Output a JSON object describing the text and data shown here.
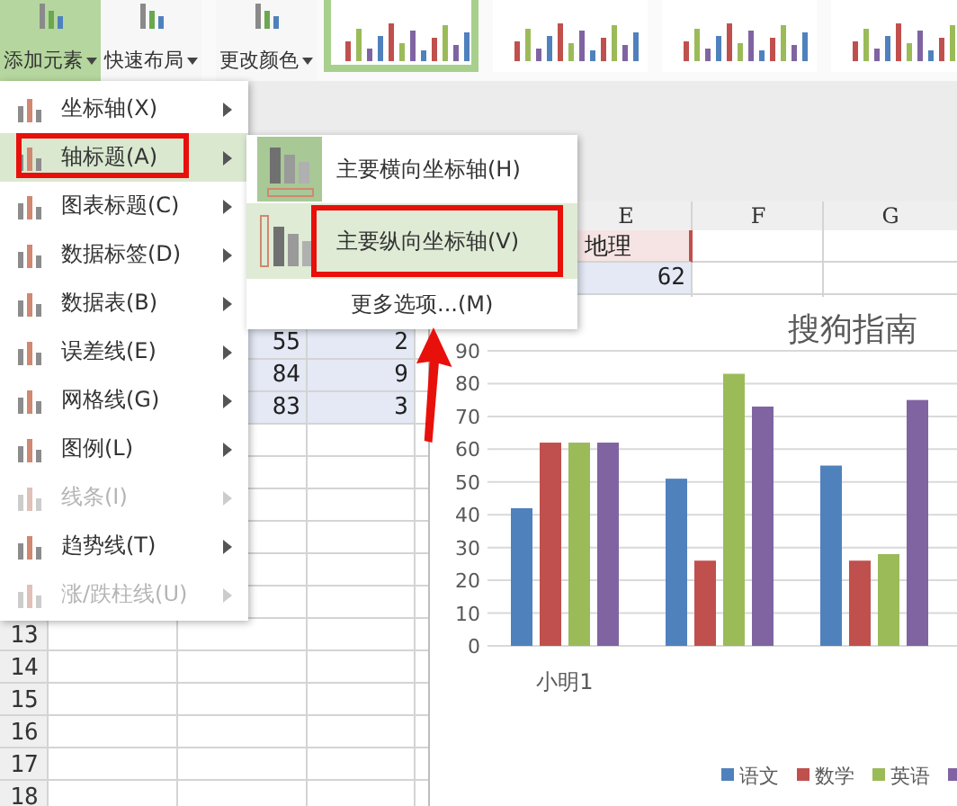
{
  "ribbon": {
    "buttons": [
      {
        "label": "添加元素",
        "selected": true
      },
      {
        "label": "快速布局",
        "selected": false
      },
      {
        "label": "更改颜色",
        "selected": false
      }
    ],
    "chart_styles": [
      {
        "selected": true
      },
      {
        "selected": false
      },
      {
        "selected": false
      },
      {
        "selected": false
      }
    ]
  },
  "sheet": {
    "column_headers": [
      "E",
      "F",
      "G"
    ],
    "row_numbers": [
      "13",
      "14",
      "15",
      "16",
      "17",
      "18"
    ],
    "cells": [
      {
        "text": "地理",
        "kind": "series_name"
      },
      {
        "text": "62",
        "kind": "value"
      },
      {
        "text": "55",
        "kind": "value"
      },
      {
        "text": "2",
        "kind": "value"
      },
      {
        "text": "84",
        "kind": "value"
      },
      {
        "text": "9",
        "kind": "value"
      },
      {
        "text": "83",
        "kind": "value"
      },
      {
        "text": "3",
        "kind": "value"
      }
    ]
  },
  "chart": {
    "chart_data": {
      "type": "bar",
      "title": "搜狗指南",
      "grid": true,
      "legend": true,
      "categories": [
        "小明1",
        null,
        null
      ],
      "ylim": [
        0,
        90
      ],
      "yticks": [
        0,
        10,
        20,
        30,
        40,
        50,
        60,
        70,
        80,
        90
      ],
      "series": [
        {
          "name": "语文",
          "color": "#4f81bd",
          "values": [
            42,
            51,
            55
          ]
        },
        {
          "name": "数学",
          "color": "#c0504d",
          "values": [
            62,
            26,
            26
          ]
        },
        {
          "name": "英语",
          "color": "#9bbb59",
          "values": [
            62,
            83,
            28
          ]
        },
        {
          "color": "#8064a2",
          "values": [
            62,
            73,
            75
          ]
        }
      ]
    }
  },
  "menu": {
    "items": [
      {
        "label": "坐标轴(X)",
        "disabled": false,
        "selected": false
      },
      {
        "label": "轴标题(A)",
        "disabled": false,
        "selected": true
      },
      {
        "label": "图表标题(C)",
        "disabled": false,
        "selected": false
      },
      {
        "label": "数据标签(D)",
        "disabled": false,
        "selected": false
      },
      {
        "label": "数据表(B)",
        "disabled": false,
        "selected": false
      },
      {
        "label": "误差线(E)",
        "disabled": false,
        "selected": false
      },
      {
        "label": "网格线(G)",
        "disabled": false,
        "selected": false
      },
      {
        "label": "图例(L)",
        "disabled": false,
        "selected": false
      },
      {
        "label": "线条(I)",
        "disabled": true,
        "selected": false
      },
      {
        "label": "趋势线(T)",
        "disabled": false,
        "selected": false
      },
      {
        "label": "涨/跌柱线(U)",
        "disabled": true,
        "selected": false
      }
    ]
  },
  "submenu": {
    "items": [
      {
        "label": "主要横向坐标轴(H)",
        "kind": "horizontal",
        "selected": false
      },
      {
        "label": "主要纵向坐标轴(V)",
        "kind": "vertical",
        "selected": true
      },
      {
        "label": "更多选项...(M)",
        "kind": "plain",
        "selected": false
      }
    ]
  }
}
